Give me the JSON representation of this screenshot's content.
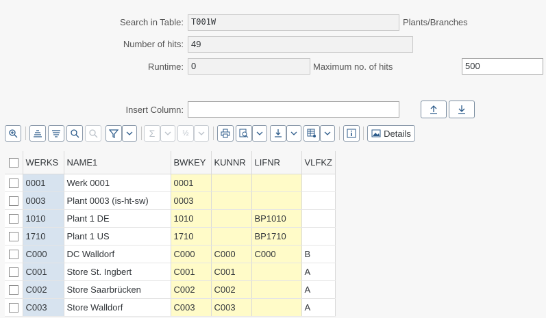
{
  "form": {
    "search_table_label": "Search in Table:",
    "search_table_value": "T001W",
    "search_table_desc": "Plants/Branches",
    "hits_label": "Number of hits:",
    "hits_value": "49",
    "runtime_label": "Runtime:",
    "runtime_value": "0",
    "max_hits_label": "Maximum no. of hits",
    "max_hits_value": "500",
    "insert_column_label": "Insert Column:",
    "insert_column_value": ""
  },
  "toolbar": {
    "icons": [
      "zoom-icon",
      "sort-ascending-icon",
      "sort-descending-icon",
      "find-icon",
      "find-next-icon",
      "filter-icon",
      "chevron-down-icon",
      "sum-icon",
      "subtotal-icon",
      "print-icon",
      "view-icon",
      "export-icon",
      "layout-icon",
      "info-icon",
      "details-icon"
    ],
    "details_label": "Details"
  },
  "table": {
    "columns": [
      "WERKS",
      "NAME1",
      "BWKEY",
      "KUNNR",
      "LIFNR",
      "VLFKZ"
    ],
    "rows": [
      [
        "0001",
        "Werk 0001",
        "0001",
        "",
        "",
        ""
      ],
      [
        "0003",
        "Plant 0003 (is-ht-sw)",
        "0003",
        "",
        "",
        ""
      ],
      [
        "1010",
        "Plant 1 DE",
        "1010",
        "",
        "BP1010",
        ""
      ],
      [
        "1710",
        "Plant 1 US",
        "1710",
        "",
        "BP1710",
        ""
      ],
      [
        "C000",
        "DC Walldorf",
        "C000",
        "C000",
        "C000",
        "B"
      ],
      [
        "C001",
        "Store St. Ingbert",
        "C001",
        "C001",
        "",
        "A"
      ],
      [
        "C002",
        "Store Saarbrücken",
        "C002",
        "C002",
        "",
        "A"
      ],
      [
        "C003",
        "Store Walldorf",
        "C003",
        "C003",
        "",
        "A"
      ]
    ]
  },
  "colors": {
    "key_column": "#d7e3ef",
    "highlight_column": "#fffbc8",
    "icon_blue": "#2b5a8a"
  }
}
